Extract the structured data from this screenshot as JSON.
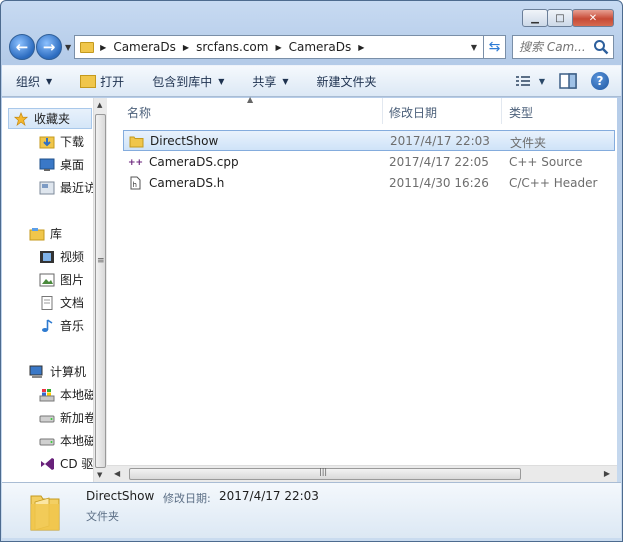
{
  "breadcrumbs": [
    "CameraDs",
    "srcfans.com",
    "CameraDs"
  ],
  "search": {
    "placeholder": "搜索 Cam..."
  },
  "toolbar": {
    "organize": "组织",
    "open": "打开",
    "include_in_library": "包含到库中",
    "share": "共享",
    "new_folder": "新建文件夹"
  },
  "sidebar": {
    "favorites": "收藏夹",
    "downloads": "下载",
    "desktop": "桌面",
    "recent": "最近访",
    "libraries": "库",
    "videos": "视频",
    "pictures": "图片",
    "documents": "文档",
    "music": "音乐",
    "computer": "计算机",
    "local_disk_1": "本地磁",
    "new_volume": "新加卷",
    "local_disk_2": "本地磁",
    "cd_drive": "CD 驱"
  },
  "columns": {
    "name": "名称",
    "date": "修改日期",
    "type": "类型"
  },
  "files": [
    {
      "name": "DirectShow",
      "date": "2017/4/17 22:03",
      "type": "文件夹",
      "icon": "folder-icon"
    },
    {
      "name": "CameraDS.cpp",
      "date": "2017/4/17 22:05",
      "type": "C++ Source",
      "icon": "cpp-file-icon"
    },
    {
      "name": "CameraDS.h",
      "date": "2011/4/30 16:26",
      "type": "C/C++ Header",
      "icon": "header-file-icon"
    }
  ],
  "details": {
    "name": "DirectShow",
    "date_label": "修改日期:",
    "date_value": "2017/4/17 22:03",
    "type": "文件夹"
  },
  "colors": {
    "accent": "#2b6bbf",
    "selection": "#cfe3f8",
    "folder": "#f0c64b"
  }
}
